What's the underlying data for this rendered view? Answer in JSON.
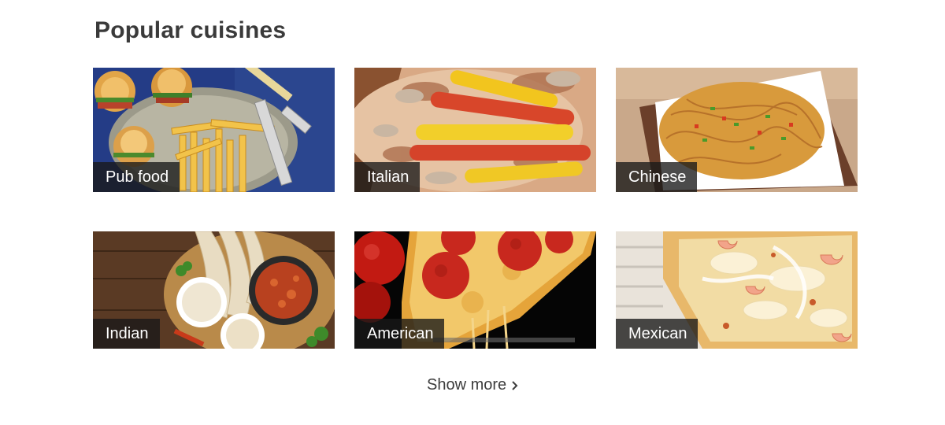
{
  "section": {
    "title": "Popular cuisines"
  },
  "cuisines": [
    {
      "label": "Pub food",
      "image_icon": "burger-and-fries-photo"
    },
    {
      "label": "Italian",
      "image_icon": "sausage-pizza-photo"
    },
    {
      "label": "Chinese",
      "image_icon": "noodles-bowl-photo"
    },
    {
      "label": "Indian",
      "image_icon": "curry-naan-rice-photo"
    },
    {
      "label": "American",
      "image_icon": "pepperoni-pizza-slice-photo"
    },
    {
      "label": "Mexican",
      "image_icon": "seafood-cheese-dish-photo"
    }
  ],
  "show_more": {
    "label": "Show more",
    "icon": "chevron-right-icon"
  },
  "colors": {
    "title": "#3a3a3a",
    "label_bg": "#181818",
    "label_text": "#ffffff",
    "link_text": "#3c3c3c"
  }
}
